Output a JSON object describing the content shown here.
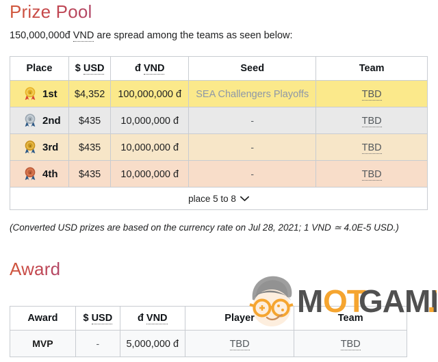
{
  "prize": {
    "title": "Prize Pool",
    "intro_prefix": "150,000,000đ ",
    "intro_abbr": "VND",
    "intro_suffix": " are spread among the teams as seen below:",
    "columns": [
      "Place",
      "$ USD",
      "đ VND",
      "Seed",
      "Team"
    ],
    "column_abbr": {
      "usd": "USD",
      "usd_symbol": "$",
      "vnd": "VND",
      "vnd_symbol": "đ"
    },
    "rows": [
      {
        "place": "1st",
        "medal": "gold-medal-icon",
        "usd": "$4,352",
        "vnd": "100,000,000 đ",
        "seed": "SEA Challengers Playoffs",
        "seed_is_link": true,
        "team": "TBD",
        "row_color": "#fbe98b"
      },
      {
        "place": "2nd",
        "medal": "silver-medal-icon",
        "usd": "$435",
        "vnd": "10,000,000 đ",
        "seed": "-",
        "seed_is_link": false,
        "team": "TBD",
        "row_color": "#e9e9e9"
      },
      {
        "place": "3rd",
        "medal": "bronze-medal-icon",
        "usd": "$435",
        "vnd": "10,000,000 đ",
        "seed": "-",
        "seed_is_link": false,
        "team": "TBD",
        "row_color": "#f7e6c8"
      },
      {
        "place": "4th",
        "medal": "copper-medal-icon",
        "usd": "$435",
        "vnd": "10,000,000 đ",
        "seed": "-",
        "seed_is_link": false,
        "team": "TBD",
        "row_color": "#f8ddc9"
      }
    ],
    "expander_label": "place 5 to 8",
    "expander_icon": "chevron-down-icon",
    "note": "(Converted USD prizes are based on the currency rate on Jul 28, 2021; 1 VND ≃ 4.0E-5 USD.)"
  },
  "award": {
    "title": "Award",
    "columns": [
      "Award",
      "$ USD",
      "đ VND",
      "Player",
      "Team"
    ],
    "rows": [
      {
        "award": "MVP",
        "usd": "-",
        "vnd": "5,000,000 đ",
        "player": "TBD",
        "team": "TBD"
      }
    ]
  },
  "watermark": {
    "text_dark": "M",
    "text_orange_1": "OT",
    "text_dark_2": "GAME",
    "text_orange_2": ".VN",
    "full_text": "MOTGAME.VN",
    "face_icon": "cartoon-face-with-glasses-icon",
    "colors": {
      "dark": "#4b4b4b",
      "orange": "#f5a32a",
      "hair": "#9b9b9b"
    }
  },
  "colors": {
    "heading": "#c8483f",
    "link": "#8d97a8",
    "tbd": "#54595d",
    "table_border": "#a2a9b1"
  }
}
